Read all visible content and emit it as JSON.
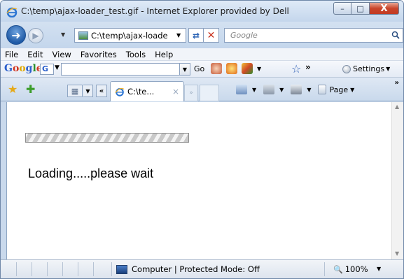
{
  "window": {
    "title": "C:\\temp\\ajax-loader_test.gif - Internet Explorer provided by Dell",
    "min_glyph": "–",
    "max_glyph": "□",
    "close_glyph": "X"
  },
  "address_bar": {
    "url": "C:\\temp\\ajax-loade",
    "search_placeholder": "Google"
  },
  "menu": {
    "items": [
      "File",
      "Edit",
      "View",
      "Favorites",
      "Tools",
      "Help"
    ]
  },
  "google_toolbar": {
    "logo": {
      "g1": "G",
      "o1": "o",
      "o2": "o",
      "g2": "g",
      "l": "l",
      "e": "e"
    },
    "menu_letter": "G",
    "go_label": "Go",
    "more_label": "»",
    "settings_label": "Settings"
  },
  "tabs": {
    "active_title": "C:\\te...",
    "close_glyph": "×",
    "scroll_label": "«",
    "more_label": "»"
  },
  "command_bar": {
    "page_label": "Page",
    "more_label": "»"
  },
  "content": {
    "loading_text": "Loading.....please wait"
  },
  "status_bar": {
    "zone_text": "Computer | Protected Mode: Off",
    "zoom_text": "100%"
  },
  "colors": {
    "frame": "#c9d9ec",
    "close_button": "#c9452b",
    "ie_blue": "#1f5aa6"
  }
}
